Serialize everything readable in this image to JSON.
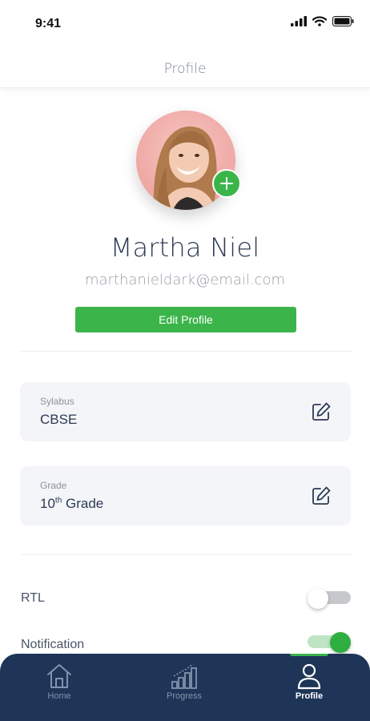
{
  "status_bar": {
    "time": "9:41"
  },
  "header": {
    "title": "Profile"
  },
  "profile": {
    "name": "Martha Niel",
    "email": "marthanieldark@email.com",
    "edit_label": "Edit Profile"
  },
  "fields": [
    {
      "label": "Sylabus",
      "value": "CBSE"
    },
    {
      "label": "Grade",
      "value_number": "10",
      "value_suffix": "th",
      "value_text": " Grade"
    }
  ],
  "settings": [
    {
      "label": "RTL",
      "enabled": false
    },
    {
      "label": "Notification",
      "enabled": true
    }
  ],
  "nav": {
    "items": [
      {
        "label": "Home",
        "icon": "home-icon"
      },
      {
        "label": "Progress",
        "icon": "progress-chart-icon"
      },
      {
        "label": "Profile",
        "icon": "user-icon",
        "active": true
      }
    ]
  },
  "colors": {
    "accent": "#3bb54a",
    "nav_bg": "#1e3557",
    "text_dark": "#2c3a55",
    "card_bg": "#f4f5f8"
  }
}
